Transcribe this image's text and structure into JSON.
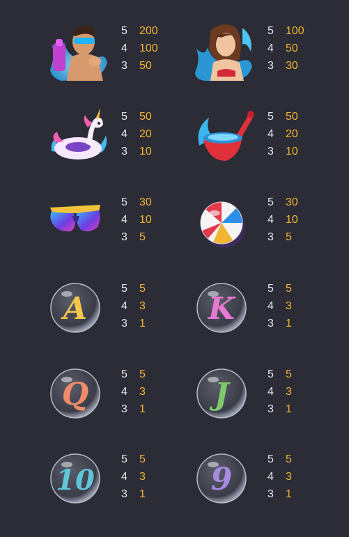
{
  "paytable": [
    {
      "symbol": "man-with-water-gun-icon",
      "rows": [
        {
          "count": "5",
          "pay": "200"
        },
        {
          "count": "4",
          "pay": "100"
        },
        {
          "count": "3",
          "pay": "50"
        }
      ]
    },
    {
      "symbol": "woman-splashing-icon",
      "rows": [
        {
          "count": "5",
          "pay": "100"
        },
        {
          "count": "4",
          "pay": "50"
        },
        {
          "count": "3",
          "pay": "30"
        }
      ]
    },
    {
      "symbol": "unicorn-float-icon",
      "rows": [
        {
          "count": "5",
          "pay": "50"
        },
        {
          "count": "4",
          "pay": "20"
        },
        {
          "count": "3",
          "pay": "10"
        }
      ]
    },
    {
      "symbol": "water-bucket-icon",
      "rows": [
        {
          "count": "5",
          "pay": "50"
        },
        {
          "count": "4",
          "pay": "20"
        },
        {
          "count": "3",
          "pay": "10"
        }
      ]
    },
    {
      "symbol": "swim-goggles-icon",
      "rows": [
        {
          "count": "5",
          "pay": "30"
        },
        {
          "count": "4",
          "pay": "10"
        },
        {
          "count": "3",
          "pay": "5"
        }
      ]
    },
    {
      "symbol": "beach-ball-icon",
      "rows": [
        {
          "count": "5",
          "pay": "30"
        },
        {
          "count": "4",
          "pay": "10"
        },
        {
          "count": "3",
          "pay": "5"
        }
      ]
    },
    {
      "symbol": "bubble-a-icon",
      "letter": "A",
      "rows": [
        {
          "count": "5",
          "pay": "5"
        },
        {
          "count": "4",
          "pay": "3"
        },
        {
          "count": "3",
          "pay": "1"
        }
      ]
    },
    {
      "symbol": "bubble-k-icon",
      "letter": "K",
      "rows": [
        {
          "count": "5",
          "pay": "5"
        },
        {
          "count": "4",
          "pay": "3"
        },
        {
          "count": "3",
          "pay": "1"
        }
      ]
    },
    {
      "symbol": "bubble-q-icon",
      "letter": "Q",
      "rows": [
        {
          "count": "5",
          "pay": "5"
        },
        {
          "count": "4",
          "pay": "3"
        },
        {
          "count": "3",
          "pay": "1"
        }
      ]
    },
    {
      "symbol": "bubble-j-icon",
      "letter": "J",
      "rows": [
        {
          "count": "5",
          "pay": "5"
        },
        {
          "count": "4",
          "pay": "3"
        },
        {
          "count": "3",
          "pay": "1"
        }
      ]
    },
    {
      "symbol": "bubble-10-icon",
      "letter": "10",
      "rows": [
        {
          "count": "5",
          "pay": "5"
        },
        {
          "count": "4",
          "pay": "3"
        },
        {
          "count": "3",
          "pay": "1"
        }
      ]
    },
    {
      "symbol": "bubble-9-icon",
      "letter": "9",
      "rows": [
        {
          "count": "5",
          "pay": "5"
        },
        {
          "count": "4",
          "pay": "3"
        },
        {
          "count": "3",
          "pay": "1"
        }
      ]
    }
  ],
  "colors": {
    "background": "#2b2c36",
    "count_text": "#e9e9ee",
    "pay_text": "#f2b531",
    "letter_a": "#f4c64a",
    "letter_k": "#e77ad0",
    "letter_q": "#f08b6a",
    "letter_j": "#7fc86a",
    "letter_10": "#5fc6d8",
    "letter_9": "#a68be0"
  }
}
